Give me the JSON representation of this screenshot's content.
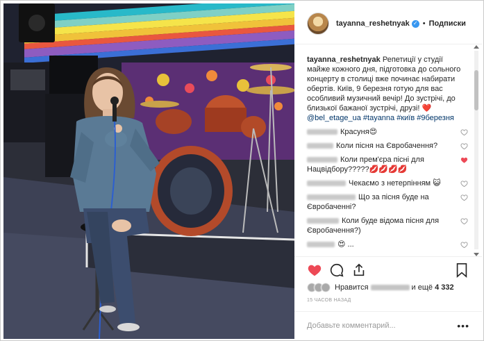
{
  "post": {
    "username": "tayanna_reshetnyak",
    "follow_label": "Подписки",
    "dot": "•",
    "caption_text": "Репетиції у студії майже кожного дня, підготовка до сольного концерту в столиці вже починає набирати обертів. Київ, 9 березня готую для вас особливий музичний вечір! До зустрічі, до близької бажаної зустрічі, друзі! ❤️",
    "hashtags": "@bel_etage_ua #tayanna #київ #9березня",
    "likes_prefix": "Нравится",
    "likes_suffix": "и ещё",
    "likes_count": "4 332",
    "time": "15 часов назад",
    "add_comment_placeholder": "Добавьте комментарий...",
    "more": "•••"
  },
  "comments": [
    {
      "text": "Красуня😍",
      "liked": false
    },
    {
      "text": "Коли пісня на Євробачення?",
      "liked": false
    },
    {
      "text": "Коли прем'єра пісні для Нацвідбору?????💋💋💋💋",
      "liked": true
    },
    {
      "text": "Чекаємо з нетерпінням 😺",
      "liked": false
    },
    {
      "text": "Що за пісня буде на Євробаченні?",
      "liked": false
    },
    {
      "text": "Коли буде відома пісня для Євробачення?)",
      "liked": false
    },
    {
      "text": "😍 ...",
      "liked": false
    }
  ],
  "icons": {
    "like": "heart-filled-icon",
    "comment": "speech-bubble-icon",
    "share": "share-icon",
    "save": "bookmark-icon",
    "verified": "verified-badge-icon"
  },
  "colors": {
    "liked": "#ed4956",
    "link": "#003569",
    "verified": "#3897f0"
  }
}
